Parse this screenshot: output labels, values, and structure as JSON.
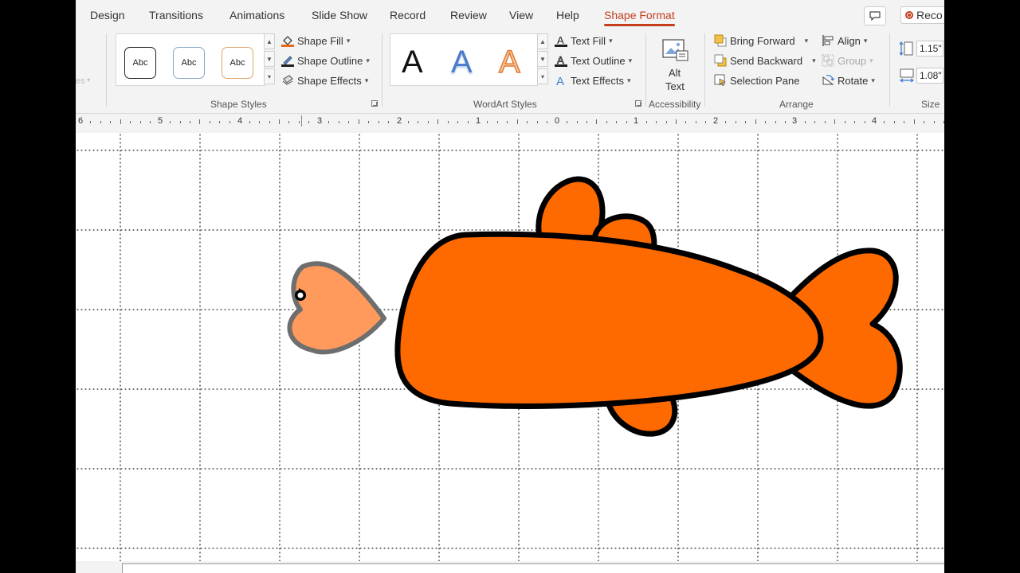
{
  "tabs": [
    "Design",
    "Transitions",
    "Animations",
    "Slide Show",
    "Record",
    "Review",
    "View",
    "Help",
    "Shape Format"
  ],
  "active_tab": "Shape Format",
  "record_label": "Reco",
  "shape_styles": {
    "label": "Shape Styles",
    "presets": [
      "Abc",
      "Abc",
      "Abc"
    ],
    "fill": "Shape Fill",
    "outline": "Shape Outline",
    "effects": "Shape Effects"
  },
  "wordart": {
    "label": "WordArt Styles",
    "presets": [
      "A",
      "A",
      "A"
    ],
    "text_fill": "Text Fill",
    "text_outline": "Text Outline",
    "text_effects": "Text Effects"
  },
  "accessibility": {
    "label": "Accessibility",
    "alt_text_line1": "Alt",
    "alt_text_line2": "Text"
  },
  "arrange": {
    "label": "Arrange",
    "bring_forward": "Bring Forward",
    "send_backward": "Send Backward",
    "selection_pane": "Selection Pane",
    "align": "Align",
    "group": "Group",
    "rotate": "Rotate"
  },
  "size": {
    "label": "Size",
    "height": "1.15\"",
    "width": "1.08\""
  },
  "partial_left_label": "es",
  "ruler_numbers": [
    "6",
    "5",
    "4",
    "3",
    "2",
    "1",
    "0",
    "1",
    "2",
    "3",
    "4"
  ],
  "colors": {
    "accent": "#c43e1c",
    "fish_fill": "#ff6a00",
    "heart_fill": "#ff9a5c",
    "heart_outline": "#6e6e6e"
  }
}
